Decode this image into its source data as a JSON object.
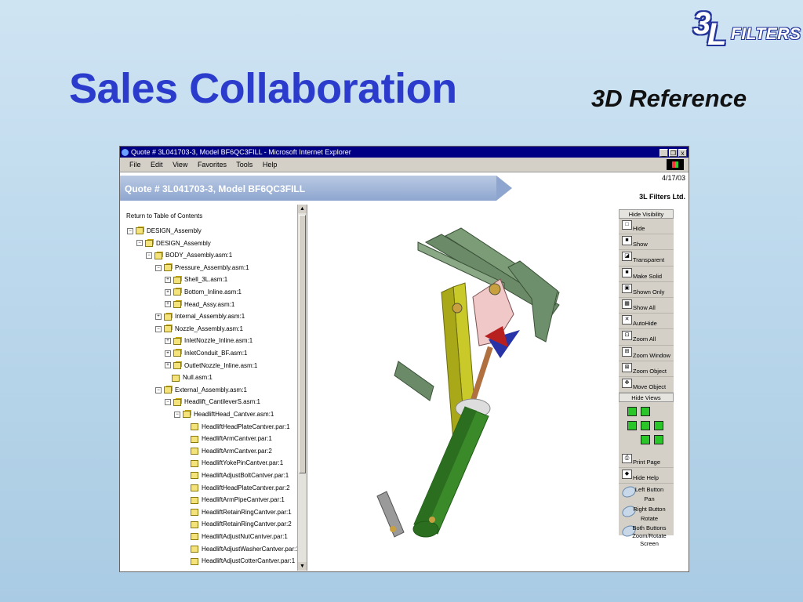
{
  "slide": {
    "title": "Sales Collaboration",
    "subtitle": "3D Reference",
    "logo": {
      "mark_num": "3",
      "mark_letter": "L",
      "word": "FILTERS"
    }
  },
  "browser": {
    "window_title": "Quote # 3L041703-3, Model BF6QC3FILL - Microsoft Internet Explorer",
    "window_buttons": [
      "_",
      "❒",
      "x"
    ],
    "menu": [
      "File",
      "Edit",
      "View",
      "Favorites",
      "Tools",
      "Help"
    ]
  },
  "page": {
    "quote_title": "Quote # 3L041703-3, Model BF6QC3FILL",
    "date": "4/17/03",
    "company": "3L Filters Ltd.",
    "toc_link": "Return to Table of Contents"
  },
  "tree": [
    {
      "label": "DESIGN_Assembly",
      "depth": 0,
      "exp": "minus"
    },
    {
      "label": "DESIGN_Assembly",
      "depth": 1,
      "exp": "minus"
    },
    {
      "label": "BODY_Assembly.asm:1",
      "depth": 2,
      "exp": "minus"
    },
    {
      "label": "Pressure_Assembly.asm:1",
      "depth": 3,
      "exp": "minus"
    },
    {
      "label": "Shell_3L.asm:1",
      "depth": 4,
      "exp": "plus"
    },
    {
      "label": "Bottom_Inline.asm:1",
      "depth": 4,
      "exp": "plus"
    },
    {
      "label": "Head_Assy.asm:1",
      "depth": 4,
      "exp": "plus"
    },
    {
      "label": "Internal_Assembly.asm:1",
      "depth": 3,
      "exp": "plus"
    },
    {
      "label": "Nozzle_Assembly.asm:1",
      "depth": 3,
      "exp": "minus"
    },
    {
      "label": "InletNozzle_Inline.asm:1",
      "depth": 4,
      "exp": "plus"
    },
    {
      "label": "InletConduit_BF.asm:1",
      "depth": 4,
      "exp": "plus"
    },
    {
      "label": "OutletNozzle_Inline.asm:1",
      "depth": 4,
      "exp": "plus"
    },
    {
      "label": "Null.asm:1",
      "depth": 4,
      "exp": "none"
    },
    {
      "label": "External_Assembly.asm:1",
      "depth": 3,
      "exp": "minus"
    },
    {
      "label": "Headlift_CantileverS.asm:1",
      "depth": 4,
      "exp": "minus"
    },
    {
      "label": "HeadliftHead_Cantver.asm:1",
      "depth": 5,
      "exp": "minus"
    },
    {
      "label": "HeadliftHeadPlateCantver.par:1",
      "depth": 6,
      "exp": "none"
    },
    {
      "label": "HeadliftArmCantver.par:1",
      "depth": 6,
      "exp": "none"
    },
    {
      "label": "HeadliftArmCantver.par:2",
      "depth": 6,
      "exp": "none"
    },
    {
      "label": "HeadliftYokePinCantver.par:1",
      "depth": 6,
      "exp": "none"
    },
    {
      "label": "HeadliftAdjustBoltCantver.par:1",
      "depth": 6,
      "exp": "none"
    },
    {
      "label": "HeadliftHeadPlateCantver.par:2",
      "depth": 6,
      "exp": "none"
    },
    {
      "label": "HeadliftArmPipeCantver.par:1",
      "depth": 6,
      "exp": "none"
    },
    {
      "label": "HeadliftRetainRingCantver.par:1",
      "depth": 6,
      "exp": "none"
    },
    {
      "label": "HeadliftRetainRingCantver.par:2",
      "depth": 6,
      "exp": "none"
    },
    {
      "label": "HeadliftAdjustNutCantver.par:1",
      "depth": 6,
      "exp": "none"
    },
    {
      "label": "HeadliftAdjustWasherCantver.par:1",
      "depth": 6,
      "exp": "none"
    },
    {
      "label": "HeadliftAdjustCotterCantver.par:1",
      "depth": 6,
      "exp": "none"
    }
  ],
  "tools": {
    "hide_visibility": "Hide Visibility",
    "items": [
      {
        "label": "Hide",
        "icon": "hide-icon"
      },
      {
        "label": "Show",
        "icon": "show-icon"
      },
      {
        "label": "Transparent",
        "icon": "transparent-icon"
      },
      {
        "label": "Make Solid",
        "icon": "make-solid-icon"
      },
      {
        "label": "Shown Only",
        "icon": "shown-only-icon"
      },
      {
        "label": "Show All",
        "icon": "show-all-icon"
      },
      {
        "label": "AutoHide",
        "icon": "autohide-icon"
      },
      {
        "label": "Zoom All",
        "icon": "zoom-all-icon"
      },
      {
        "label": "Zoom Window",
        "icon": "zoom-window-icon"
      },
      {
        "label": "Zoom Object",
        "icon": "zoom-object-icon"
      },
      {
        "label": "Move Object",
        "icon": "move-object-icon"
      }
    ],
    "hide_views": "Hide Views",
    "print_page": "Print Page",
    "hide_help": "Hide Help",
    "mouse_help": [
      {
        "button": "Left Button",
        "action": "Pan"
      },
      {
        "button": "Right Button",
        "action": "Rotate"
      },
      {
        "button": "Both Buttons",
        "action": "Zoom/Rotate Screen"
      }
    ]
  }
}
